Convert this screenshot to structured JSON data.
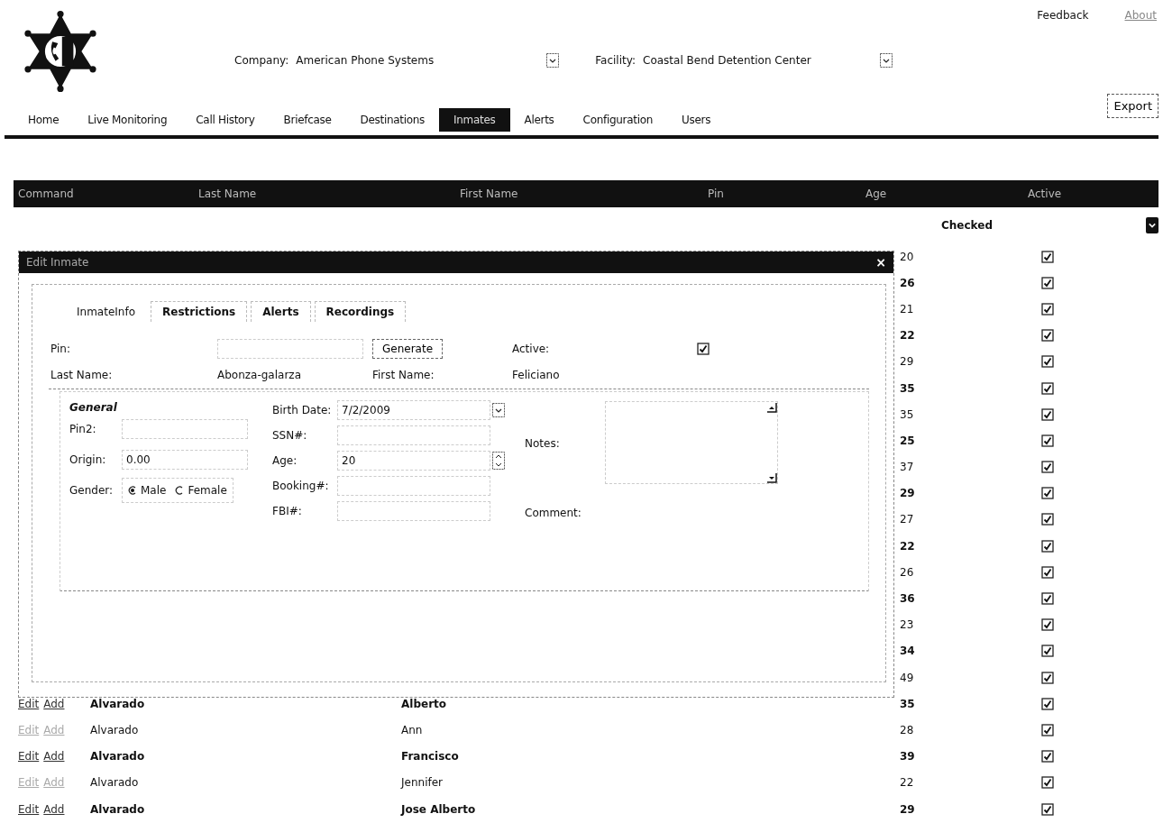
{
  "header": {
    "company": {
      "label": "Company:",
      "value": "American Phone Systems"
    },
    "facility": {
      "label": "Facility:",
      "value": "Coastal Bend Detention Center"
    },
    "links": [
      "Feedback",
      "About"
    ],
    "nav": [
      {
        "label": "Home",
        "selected": false
      },
      {
        "label": "Live Monitoring",
        "selected": false
      },
      {
        "label": "Call History",
        "selected": false
      },
      {
        "label": "Briefcase",
        "selected": false
      },
      {
        "label": "Destinations",
        "selected": false
      },
      {
        "label": "Inmates",
        "selected": true
      },
      {
        "label": "Alerts",
        "selected": false
      },
      {
        "label": "Configuration",
        "selected": false
      },
      {
        "label": "Users",
        "selected": false
      }
    ],
    "export": "Export"
  },
  "table": {
    "columns": [
      "Command",
      "Last Name",
      "First Name",
      "Pin",
      "Age",
      "Active"
    ],
    "filter": "Checked",
    "rows": [
      {
        "age": "20",
        "active": true
      },
      {
        "age": "26",
        "active": true
      },
      {
        "age": "21",
        "active": true
      },
      {
        "age": "22",
        "active": true
      },
      {
        "age": "29",
        "active": true
      },
      {
        "age": "35",
        "active": true
      },
      {
        "age": "35",
        "active": true
      },
      {
        "age": "25",
        "active": true
      },
      {
        "age": "37",
        "active": true
      },
      {
        "age": "29",
        "active": true
      },
      {
        "age": "27",
        "active": true
      },
      {
        "age": "22",
        "active": true
      },
      {
        "age": "26",
        "active": true
      },
      {
        "age": "36",
        "active": true
      },
      {
        "age": "23",
        "active": true
      },
      {
        "age": "34",
        "active": true
      },
      {
        "age": "49",
        "active": true
      },
      {
        "commands": [
          "Edit",
          "Add"
        ],
        "last_name": "Alvarado",
        "first_name": "Alberto",
        "age": "35",
        "active": true
      },
      {
        "commands": [
          "Edit",
          "Add"
        ],
        "last_name": "Alvarado",
        "first_name": "Ann",
        "age": "28",
        "active": true
      },
      {
        "commands": [
          "Edit",
          "Add"
        ],
        "last_name": "Alvarado",
        "first_name": "Francisco",
        "age": "39",
        "active": true
      },
      {
        "commands": [
          "Edit",
          "Add"
        ],
        "last_name": "Alvarado",
        "first_name": "Jennifer",
        "age": "22",
        "active": true
      },
      {
        "commands": [
          "Edit",
          "Add"
        ],
        "last_name": "Alvarado",
        "first_name": "Jose Alberto",
        "age": "29",
        "active": true
      }
    ]
  },
  "dialog": {
    "title": "Edit Inmate",
    "close": "×",
    "tabs": [
      {
        "label": "InmateInfo",
        "selected": true
      },
      {
        "label": "Restrictions",
        "selected": false
      },
      {
        "label": "Alerts",
        "selected": false
      },
      {
        "label": "Recordings",
        "selected": false
      }
    ],
    "pin_label": "Pin:",
    "generate": "Generate",
    "active_label": "Active:",
    "active": true,
    "last_name_label": "Last Name:",
    "last_name": "Abonza-galarza",
    "first_name_label": "First Name:",
    "first_name": "Feliciano",
    "general": {
      "title": "General",
      "pin2_label": "Pin2:",
      "origin_label": "Origin:",
      "origin": "0.00",
      "gender_label": "Gender:",
      "genders": [
        {
          "label": "Male",
          "selected": true
        },
        {
          "label": "Female",
          "selected": false
        }
      ],
      "birth_label": "Birth Date:",
      "birth": "7/2/2009",
      "ssn_label": "SSN#:",
      "age_label": "Age:",
      "age": "20",
      "booking_label": "Booking#:",
      "fbi_label": "FBI#:",
      "notes_label": "Notes:",
      "comment_label": "Comment:"
    }
  }
}
